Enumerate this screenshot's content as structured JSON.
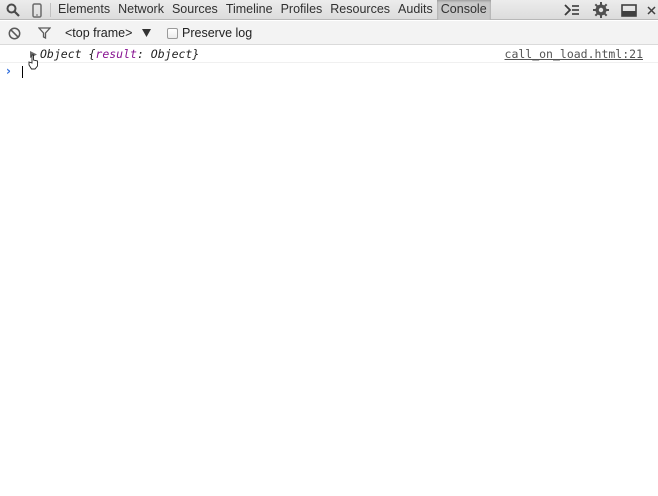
{
  "toolbar": {
    "tabs": [
      {
        "label": "Elements"
      },
      {
        "label": "Network"
      },
      {
        "label": "Sources"
      },
      {
        "label": "Timeline"
      },
      {
        "label": "Profiles"
      },
      {
        "label": "Resources"
      },
      {
        "label": "Audits"
      },
      {
        "label": "Console",
        "selected": true
      }
    ],
    "icons": {
      "search": "search-icon",
      "device": "device-mode-icon",
      "drawer": "show-drawer-icon",
      "settings": "gear-icon",
      "dock": "dock-side-icon",
      "close": "close-icon"
    }
  },
  "filterbar": {
    "frame_select": "<top frame>",
    "preserve_log_label": "Preserve log",
    "preserve_log_checked": false
  },
  "console": {
    "messages": [
      {
        "prefix": "Object {",
        "key": "result",
        "separator": ": ",
        "value": "Object",
        "suffix": "}",
        "source": "call_on_load.html:21"
      }
    ],
    "prompt_symbol": "›",
    "prompt_value": ""
  },
  "colors": {
    "object_key": "#881391",
    "prompt": "#2f6ddc"
  }
}
